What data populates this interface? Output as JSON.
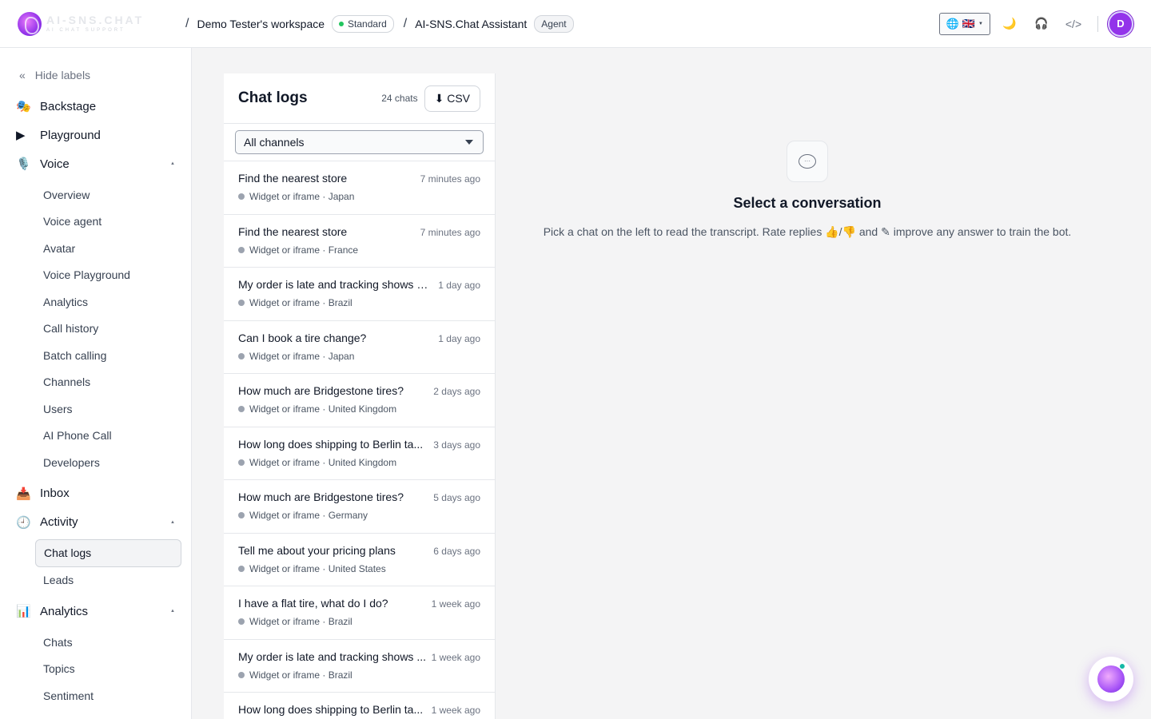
{
  "header": {
    "logo_name": "AI-SNS.CHAT",
    "logo_sub": "AI CHAT SUPPORT",
    "workspace": "Demo Tester's workspace",
    "plan_badge": "Standard",
    "assistant": "AI-SNS.Chat Assistant",
    "assistant_badge": "Agent",
    "separator": "/",
    "language_globe": "🌐",
    "language_flag": "🇬🇧",
    "theme_icon": "🌙",
    "support_icon": "🎧",
    "code_icon": "</>",
    "avatar_initial": "D"
  },
  "sidebar": {
    "hide_labels": "Hide labels",
    "collapse_icon": "«",
    "backstage": {
      "icon": "🎭",
      "label": "Backstage"
    },
    "playground": {
      "icon": "▶",
      "label": "Playground"
    },
    "voice": {
      "icon": "🎙️",
      "label": "Voice",
      "items": [
        "Overview",
        "Voice agent",
        "Avatar",
        "Voice Playground",
        "Analytics",
        "Call history",
        "Batch calling",
        "Channels",
        "Users",
        "AI Phone Call",
        "Developers"
      ]
    },
    "inbox": {
      "icon": "📥",
      "label": "Inbox"
    },
    "activity": {
      "icon": "🕘",
      "label": "Activity",
      "items": [
        "Chat logs",
        "Leads"
      ],
      "active": "Chat logs"
    },
    "analytics": {
      "icon": "📊",
      "label": "Analytics",
      "items": [
        "Chats",
        "Topics",
        "Sentiment"
      ]
    },
    "expand_glyph": "▲"
  },
  "chat_list": {
    "title": "Chat logs",
    "count": "24 chats",
    "csv_label": "⬇ CSV",
    "filter_value": "All channels",
    "chats": [
      {
        "title": "Find the nearest store",
        "time": "7 minutes ago",
        "source": "Widget or iframe · Japan"
      },
      {
        "title": "Find the nearest store",
        "time": "7 minutes ago",
        "source": "Widget or iframe · France"
      },
      {
        "title": "My order is late and tracking shows n...",
        "time": "1 day ago",
        "source": "Widget or iframe · Brazil"
      },
      {
        "title": "Can I book a tire change?",
        "time": "1 day ago",
        "source": "Widget or iframe · Japan"
      },
      {
        "title": "How much are Bridgestone tires?",
        "time": "2 days ago",
        "source": "Widget or iframe · United Kingdom"
      },
      {
        "title": "How long does shipping to Berlin ta...",
        "time": "3 days ago",
        "source": "Widget or iframe · United Kingdom"
      },
      {
        "title": "How much are Bridgestone tires?",
        "time": "5 days ago",
        "source": "Widget or iframe · Germany"
      },
      {
        "title": "Tell me about your pricing plans",
        "time": "6 days ago",
        "source": "Widget or iframe · United States"
      },
      {
        "title": "I have a flat tire, what do I do?",
        "time": "1 week ago",
        "source": "Widget or iframe · Brazil"
      },
      {
        "title": "My order is late and tracking shows ...",
        "time": "1 week ago",
        "source": "Widget or iframe · Brazil"
      },
      {
        "title": "How long does shipping to Berlin ta...",
        "time": "1 week ago",
        "source": ""
      }
    ]
  },
  "empty_state": {
    "icon": "···",
    "title": "Select a conversation",
    "description": "Pick a chat on the left to read the transcript. Rate replies 👍/👎 and ✎ improve any answer to train the bot."
  },
  "colors": {
    "accent": "#9333ea",
    "status_green": "#22c55e",
    "channel_dot": "#9ca3af"
  }
}
